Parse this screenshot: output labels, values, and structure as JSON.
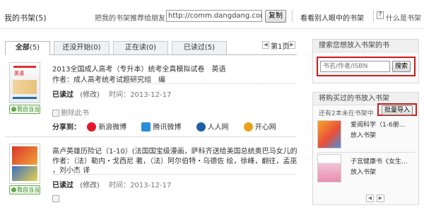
{
  "header": {
    "title": "我的书架",
    "count": "(5)",
    "recommend_label": "把我的书架推荐给朋友：",
    "url_value": "http://comm.dangdang.com/mer",
    "copy_button": "复制",
    "see_others": "看看别人眼中的书架",
    "help_icon_char": "?",
    "what_is": "什么是书架"
  },
  "tabs": [
    {
      "label": "全部",
      "count": "(5)"
    },
    {
      "label": "还没开始",
      "count": "(0)"
    },
    {
      "label": "正在读",
      "count": "(0)"
    },
    {
      "label": "已读过",
      "count": "(5)"
    }
  ],
  "pager": {
    "page": "第1页"
  },
  "books": [
    {
      "title": "2013全国成人高考（专升本）统考全真模拟试卷　英语",
      "author_label": "作者：",
      "author": "成人高考统考试题研究组　编",
      "status": "已读过",
      "modify": "(修改)",
      "date_label": "时间：",
      "date": "2013-12-17",
      "delete": "删除此书",
      "badge": "我自当当",
      "cover_text": "英语"
    },
    {
      "title": "高卢英雄历险记（1-10）(法国国宝级漫画，萨科齐送给美国总统奥巴马女儿的礼...",
      "author_label": "作者：",
      "author_line1": "（法）勒内・戈西尼 著，（法）阿尔伯特・乌德佐 绘，徐峰，翻往，孟巫，金整",
      "author_line2": "，刘小杰 译",
      "status": "已读过",
      "modify": "(修改)",
      "date_label": "时间：",
      "date": "2013-12-17",
      "badge": "我自当当"
    }
  ],
  "share": {
    "label": "分享到：",
    "items": [
      {
        "name": "新浪微博",
        "color": "#e6162d"
      },
      {
        "name": "腾讯微博",
        "color": "#2a8fd8"
      },
      {
        "name": "人人网",
        "color": "#1e5fa8"
      },
      {
        "name": "开心网",
        "color": "#e9a21b"
      }
    ]
  },
  "sidebar": {
    "search_title": "搜索您想放入书架的书",
    "search_placeholder": "书名/作者/ISBN",
    "search_button": "搜索",
    "import_title": "将购买过的书放入书架",
    "remaining": "还有2本未在书架中",
    "batch_button": "批量导入",
    "items": [
      {
        "title": "爱阅科学（1-6册...",
        "action": "放入书架"
      },
      {
        "title": "子宫健康书《女生...",
        "action": "放入书架"
      }
    ],
    "prev_arrow": "◀",
    "next_arrow": "▶"
  },
  "colors": {
    "accent_red": "#cc1b1b",
    "tab_bg": "#eef1f5"
  }
}
